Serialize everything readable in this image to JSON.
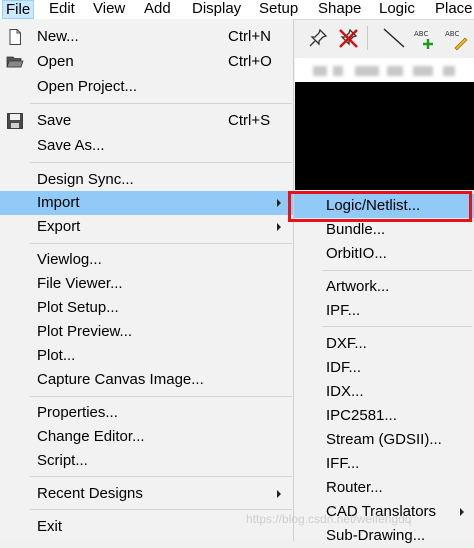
{
  "menubar": {
    "items": [
      "File",
      "Edit",
      "View",
      "Add",
      "Display",
      "Setup",
      "Shape",
      "Logic",
      "Place"
    ],
    "active_index": 0
  },
  "toolbar": {
    "icons": [
      "pin-icon",
      "unpin-icon",
      "line-tool-icon",
      "add-text-icon",
      "edit-text-icon"
    ]
  },
  "file_menu": {
    "items": [
      {
        "label": "New...",
        "shortcut": "Ctrl+N",
        "icon": "new-file-icon"
      },
      {
        "label": "Open",
        "shortcut": "Ctrl+O",
        "icon": "open-folder-icon"
      },
      {
        "label": "Open Project..."
      },
      {
        "label": "Save",
        "shortcut": "Ctrl+S",
        "icon": "save-disk-icon"
      },
      {
        "label": "Save As..."
      },
      {
        "label": "Design Sync..."
      },
      {
        "label": "Import",
        "submenu": true,
        "highlighted": true
      },
      {
        "label": "Export",
        "submenu": true
      },
      {
        "label": "Viewlog..."
      },
      {
        "label": "File Viewer..."
      },
      {
        "label": "Plot Setup..."
      },
      {
        "label": "Plot Preview..."
      },
      {
        "label": "Plot..."
      },
      {
        "label": "Capture Canvas Image..."
      },
      {
        "label": "Properties..."
      },
      {
        "label": "Change Editor..."
      },
      {
        "label": "Script..."
      },
      {
        "label": "Recent Designs",
        "submenu": true
      },
      {
        "label": "Exit"
      }
    ]
  },
  "import_submenu": {
    "items": [
      {
        "label": "Logic/Netlist...",
        "highlighted": true
      },
      {
        "label": "Bundle..."
      },
      {
        "label": "OrbitIO..."
      },
      {
        "label": "Artwork..."
      },
      {
        "label": "IPF..."
      },
      {
        "label": "DXF..."
      },
      {
        "label": "IDF..."
      },
      {
        "label": "IDX..."
      },
      {
        "label": "IPC2581..."
      },
      {
        "label": "Stream (GDSII)..."
      },
      {
        "label": "IFF..."
      },
      {
        "label": "Router..."
      },
      {
        "label": "CAD Translators",
        "submenu": true
      },
      {
        "label": "Sub-Drawing..."
      }
    ]
  },
  "watermark": "https://blog.csdn.net/weifengdq",
  "colors": {
    "highlight": "#91c9f7",
    "callout": "#e8101b",
    "menubar_active": "#cce8ff"
  }
}
